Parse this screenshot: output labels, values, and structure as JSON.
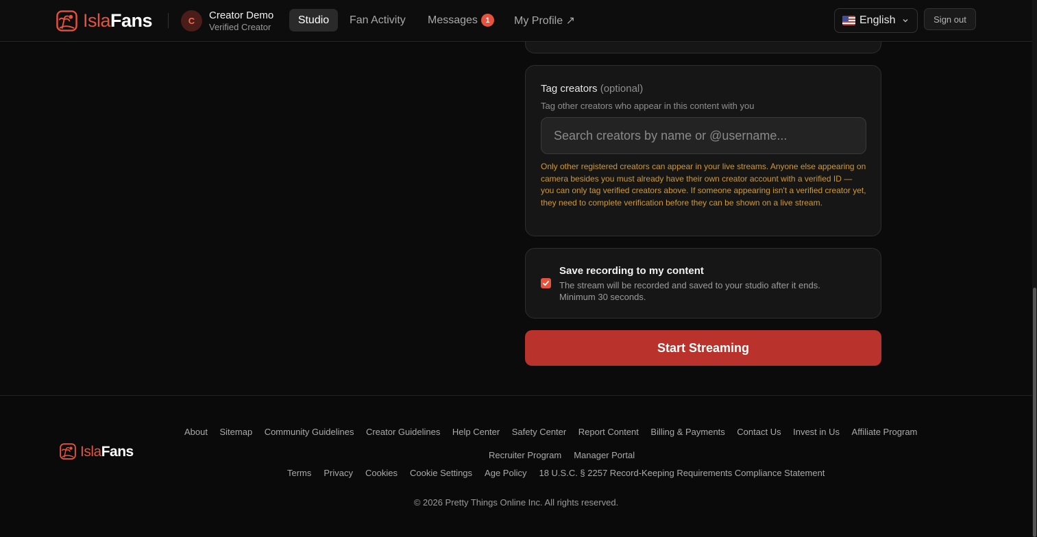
{
  "brand": {
    "part1": "Isla",
    "part2": "Fans",
    "accent_color": "#e5533f"
  },
  "header": {
    "user": {
      "initial": "C",
      "name": "Creator Demo",
      "role": "Verified Creator"
    },
    "nav": [
      {
        "label": "Studio",
        "active": true
      },
      {
        "label": "Fan Activity",
        "active": false
      },
      {
        "label": "Messages",
        "badge": "1",
        "active": false
      },
      {
        "label": "My Profile ↗",
        "active": false
      }
    ],
    "language": {
      "label": "English",
      "flag_icon": "us-flag-icon"
    },
    "sign_out": "Sign out"
  },
  "tag_creators": {
    "title": "Tag creators",
    "optional": "(optional)",
    "subtitle": "Tag other creators who appear in this content with you",
    "placeholder": "Search creators by name or @username...",
    "notice": "Only other registered creators can appear in your live streams. Anyone else appearing on camera besides you must already have their own creator account with a verified ID — you can only tag verified creators above. If someone appearing isn't a verified creator yet, they need to complete verification before they can be shown on a live stream."
  },
  "recording": {
    "checked": true,
    "title": "Save recording to my content",
    "description": "The stream will be recorded and saved to your studio after it ends. Minimum 30 seconds."
  },
  "start_button": "Start Streaming",
  "footer": {
    "links_row1": [
      "About",
      "Sitemap",
      "Community Guidelines",
      "Creator Guidelines",
      "Help Center",
      "Safety Center",
      "Report Content",
      "Billing & Payments",
      "Contact Us",
      "Invest in Us",
      "Affiliate Program"
    ],
    "links_row2": [
      "Recruiter Program",
      "Manager Portal"
    ],
    "links_row3": [
      "Terms",
      "Privacy",
      "Cookies",
      "Cookie Settings",
      "Age Policy",
      "18 U.S.C. § 2257 Record-Keeping Requirements Compliance Statement"
    ],
    "copyright": "© 2026 Pretty Things Online Inc. All rights reserved."
  }
}
